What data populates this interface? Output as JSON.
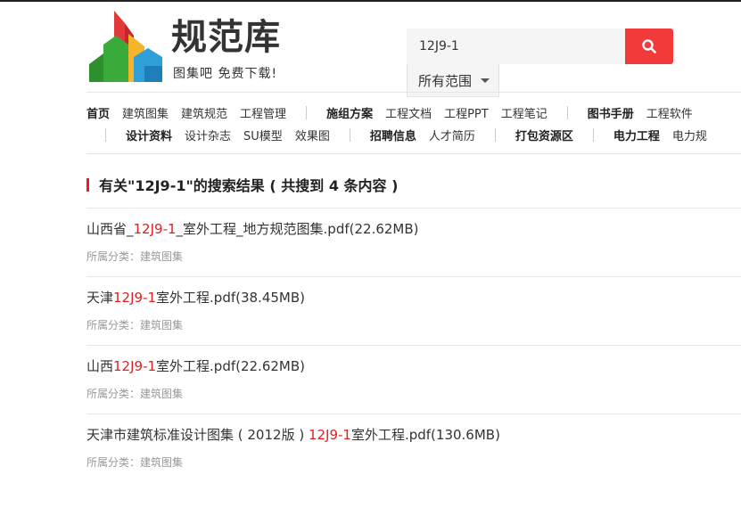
{
  "brand": {
    "title": "规范库",
    "slogan": "图集吧  免费下载!"
  },
  "search": {
    "value": "12J9-1",
    "placeholder": "",
    "scope_label": "所有范围"
  },
  "nav": {
    "row1": [
      {
        "label": "首页",
        "strong": true
      },
      {
        "label": "建筑图集"
      },
      {
        "label": "建筑规范"
      },
      {
        "label": "工程管理",
        "sep_after": true
      },
      {
        "label": "施组方案",
        "strong": true
      },
      {
        "label": "工程文档"
      },
      {
        "label": "工程PPT"
      },
      {
        "label": "工程笔记",
        "sep_after": true
      },
      {
        "label": "图书手册",
        "strong": true
      },
      {
        "label": "工程软件"
      }
    ],
    "row2": [
      {
        "label": "设计资料",
        "strong": true
      },
      {
        "label": "设计杂志"
      },
      {
        "label": "SU模型"
      },
      {
        "label": "效果图",
        "sep_after": true
      },
      {
        "label": "招聘信息",
        "strong": true
      },
      {
        "label": "人才简历",
        "sep_after": true
      },
      {
        "label": "打包资源区",
        "strong": true,
        "sep_after": true
      },
      {
        "label": "电力工程",
        "strong": true
      },
      {
        "label": "电力规"
      }
    ]
  },
  "results": {
    "heading": "有关\"12J9-1\"的搜索结果 ( 共搜到 4 条内容 )",
    "items": [
      {
        "pre": "山西省_",
        "hl": "12J9-1",
        "post": "_室外工程_地方规范图集.pdf(22.62MB)",
        "category": "所属分类：建筑图集"
      },
      {
        "pre": "天津",
        "hl": "12J9-1",
        "post": "室外工程.pdf(38.45MB)",
        "category": "所属分类：建筑图集"
      },
      {
        "pre": "山西",
        "hl": "12J9-1",
        "post": "室外工程.pdf(22.62MB)",
        "category": "所属分类：建筑图集"
      },
      {
        "pre": "天津市建筑标准设计图集 ( 2012版 ) ",
        "hl": "12J9-1",
        "post": "室外工程.pdf(130.6MB)",
        "category": "所属分类：建筑图集"
      }
    ]
  },
  "colors": {
    "accent": "#f23a3a",
    "highlight": "#e02020"
  }
}
